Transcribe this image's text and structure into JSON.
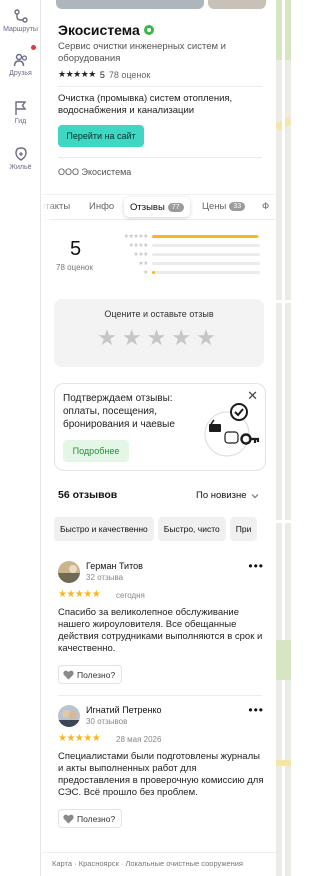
{
  "rail": {
    "routes_label": "Маршруты",
    "friends_label": "Друзья",
    "guide_label": "Гид",
    "housing_label": "Жильё"
  },
  "org": {
    "name": "Экосистема",
    "subtitle": "Сервис очистки инженерных систем и оборудования",
    "rating": "5",
    "rating_count": "78 оценок",
    "description": "Очистка (промывка) систем отопления, водоснабжения и канализации",
    "site_button": "Перейти на сайт",
    "legal_name": "ООО Экосистема"
  },
  "tabs": [
    {
      "label": "нтакты",
      "badge": ""
    },
    {
      "label": "Инфо",
      "badge": ""
    },
    {
      "label": "Отзывы",
      "badge": "77"
    },
    {
      "label": "Цены",
      "badge": "33"
    },
    {
      "label": "Ф",
      "badge": ""
    }
  ],
  "summary": {
    "score": "5",
    "count": "78 оценок",
    "bars": [
      0.98,
      0.0,
      0.0,
      0.0,
      0.03
    ]
  },
  "rate": {
    "title": "Оцените и оставьте отзыв"
  },
  "promo": {
    "text": "Подтверждаем отзывы: оплаты, посещения, бронирования и чаевые",
    "button": "Подробнее"
  },
  "reviews_header": {
    "count": "56 отзывов",
    "sort": "По новизне"
  },
  "chips": [
    "Быстро и качественно",
    "Быстро, чисто",
    "При"
  ],
  "reviews": [
    {
      "name": "Герман Титов",
      "sub": "32 отзыва",
      "stars": 5,
      "date": "сегодня",
      "text": "Спасибо за великолепное обслуживание нашего жироуловителя. Все обещанные действия сотрудниками выполняются в срок и качественно.",
      "useful": "Полезно?"
    },
    {
      "name": "Игнатий Петренко",
      "sub": "30 отзывов",
      "stars": 5,
      "date": "28 мая 2026",
      "text": "Специалистами были подготовлены журналы и акты выполненных работ для предоставления в проверочную комиссию для СЭС. Всё прошло без проблем.",
      "useful": "Полезно?"
    }
  ],
  "footer": {
    "breadcrumb": "Карта · Красноярск · Локальные очистные сооружения"
  },
  "colors": {
    "accent": "#3fd6c2",
    "star": "#f5b820",
    "verified": "#3bb54a"
  }
}
